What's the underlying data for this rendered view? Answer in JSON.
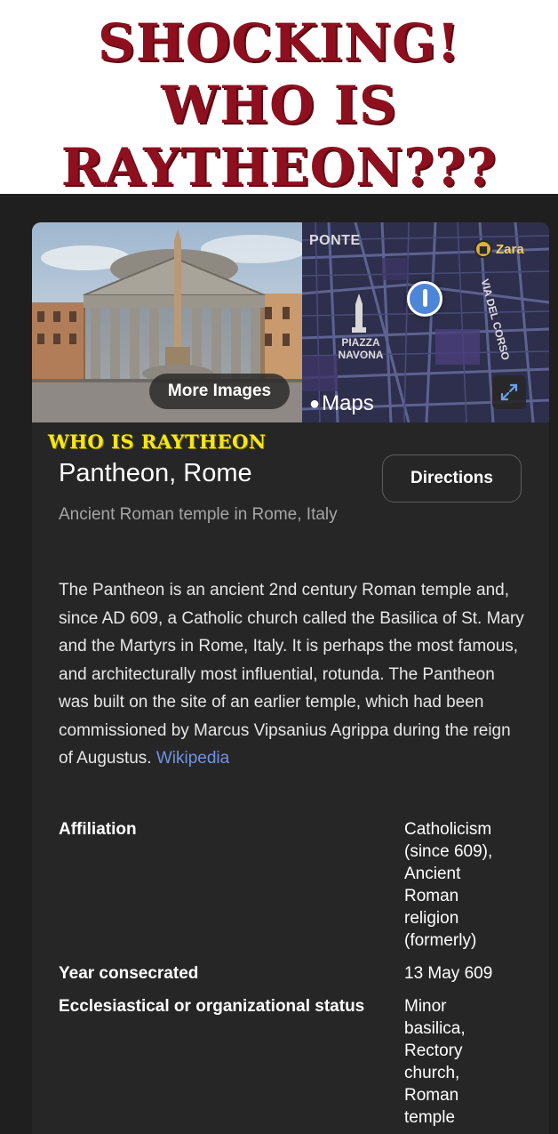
{
  "meme": {
    "line1": "SHOCKING!",
    "line2": "WHO IS",
    "line3": "RAYTHEON???"
  },
  "overlay_caption": "WHO IS RAYTHEON",
  "card": {
    "more_images_label": "More Images",
    "map": {
      "label_ponte": "PONTE",
      "label_piazza": "PIAZZA NAVONA",
      "label_corso": "VIA DEL CORSO",
      "label_zara": "Zara",
      "maps_logo": "Maps"
    },
    "title": "Pantheon, Rome",
    "directions_label": "Directions",
    "subtitle": "Ancient Roman temple in Rome, Italy",
    "description": "The Pantheon is an ancient 2nd century Roman temple and, since AD 609, a Catholic church called the Basilica of St. Mary and the Martyrs in Rome, Italy. It is perhaps the most famous, and architecturally most influential, rotunda. The Pantheon was built on the site of an earlier temple, which had been commissioned by Marcus Vipsanius Agrippa during the reign of Augustus.",
    "wiki_link": "Wikipedia",
    "facts": [
      {
        "key": "Affiliation",
        "value": "Catholicism (since 609), Ancient Roman religion (formerly)"
      },
      {
        "key": "Year consecrated",
        "value": "13 May 609"
      },
      {
        "key": "Ecclesiastical or organizational status",
        "value": "Minor basilica, Rectory church, Roman temple"
      }
    ]
  },
  "colors": {
    "meme_red": "#8e0f1e",
    "overlay_yellow": "#f5e619",
    "card_bg": "#262626",
    "link_blue": "#6f93e4"
  },
  "icons": [
    "apple-logo-icon",
    "expand-icon",
    "location-pin-icon",
    "shopping-bag-icon",
    "obelisk-icon"
  ]
}
